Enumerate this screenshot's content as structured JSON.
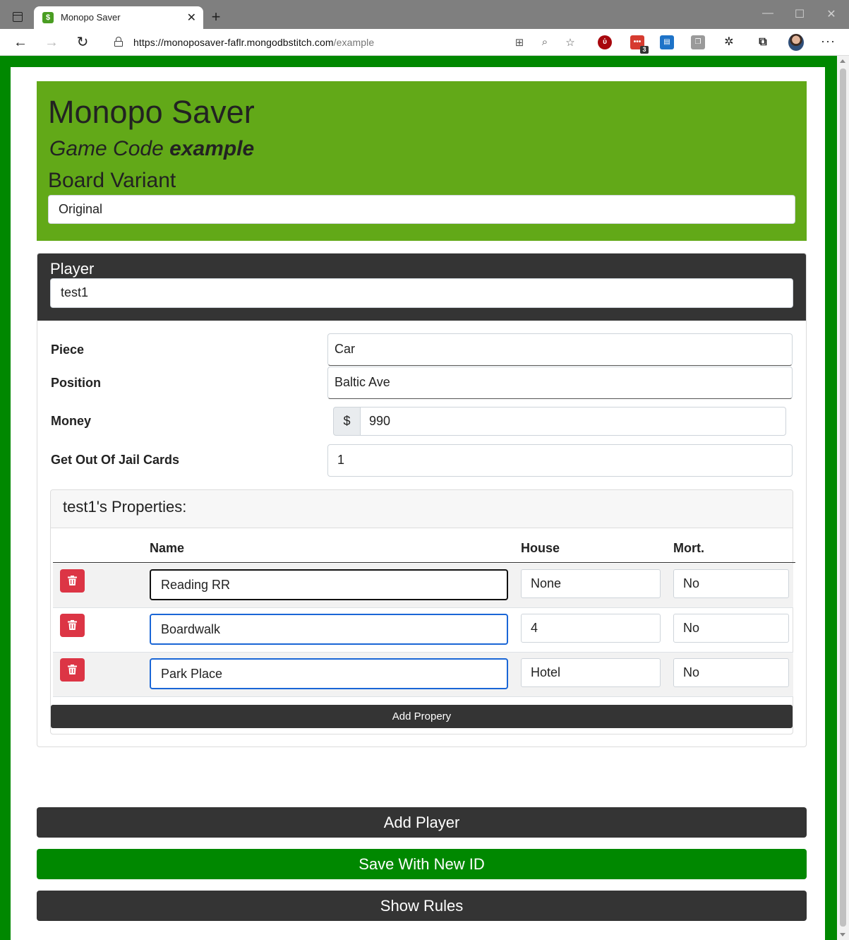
{
  "browser": {
    "tab_title": "Monopo Saver",
    "url_host": "https://monoposaver-faflr.mongodbstitch.com",
    "url_path": "/example",
    "ext_badge": "3"
  },
  "header": {
    "title": "Monopo Saver",
    "game_code_label": "Game Code",
    "game_code": "example",
    "variant_label": "Board Variant",
    "variant_value": "Original"
  },
  "player": {
    "label": "Player",
    "name": "test1",
    "fields": {
      "piece_label": "Piece",
      "piece_value": "Car",
      "position_label": "Position",
      "position_value": "Baltic Ave",
      "money_label": "Money",
      "money_symbol": "$",
      "money_value": "990",
      "jail_label": "Get Out Of Jail Cards",
      "jail_value": "1"
    },
    "properties": {
      "title": "test1's Properties:",
      "columns": {
        "name": "Name",
        "house": "House",
        "mort": "Mort."
      },
      "rows": [
        {
          "name": "Reading RR",
          "house": "None",
          "mort": "No"
        },
        {
          "name": "Boardwalk",
          "house": "4",
          "mort": "No"
        },
        {
          "name": "Park Place",
          "house": "Hotel",
          "mort": "No"
        }
      ],
      "add_label": "Add Propery"
    }
  },
  "actions": {
    "add_player": "Add Player",
    "save_new_id": "Save With New ID",
    "show_rules": "Show Rules"
  },
  "colors": {
    "page_bg": "#008800",
    "header_bg": "#62a918",
    "dark": "#343434",
    "danger": "#dc3545",
    "focus": "#1a66d6"
  }
}
